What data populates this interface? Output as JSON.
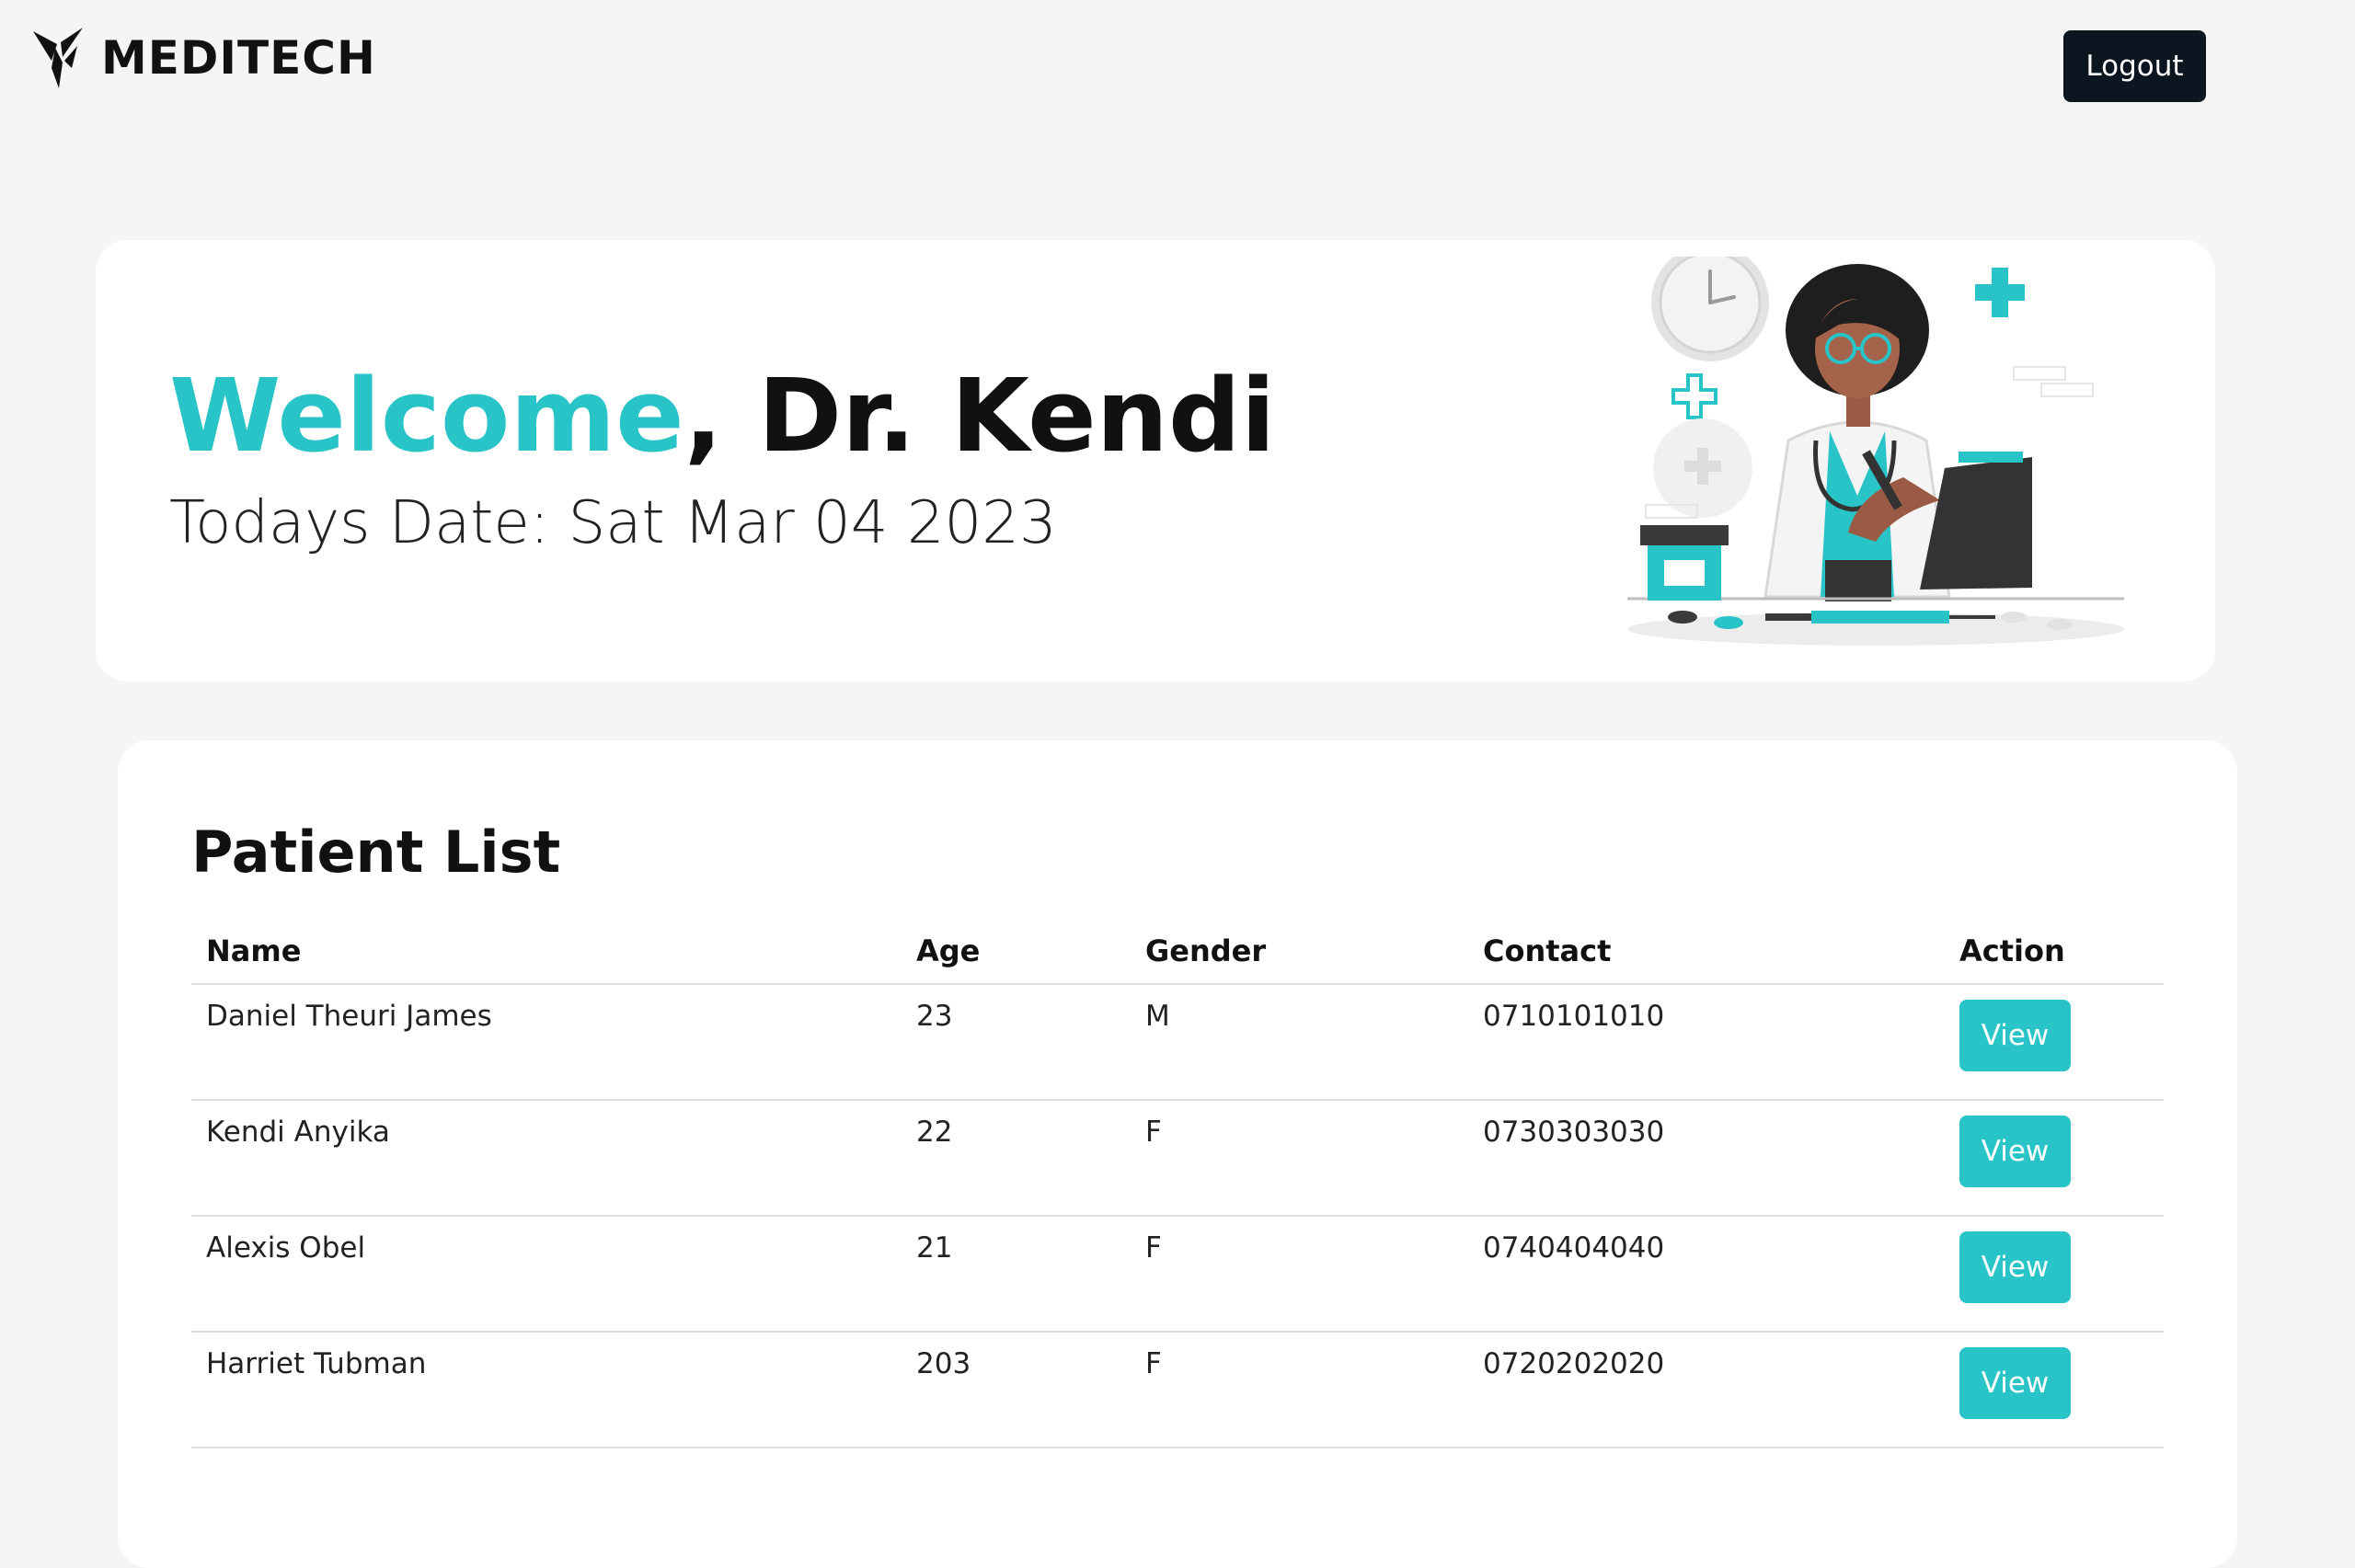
{
  "header": {
    "brand_name": "MEDITECH",
    "logout_label": "Logout"
  },
  "welcome": {
    "greeting_word": "Welcome",
    "greeting_rest": ", Dr. Kendi",
    "date_text": "Todays Date: Sat Mar 04 2023"
  },
  "patients": {
    "title": "Patient List",
    "columns": [
      "Name",
      "Age",
      "Gender",
      "Contact",
      "Action"
    ],
    "rows": [
      {
        "name": "Daniel Theuri James",
        "age": "23",
        "gender": "M",
        "contact": "0710101010",
        "action": "View"
      },
      {
        "name": "Kendi Anyika",
        "age": "22",
        "gender": "F",
        "contact": "0730303030",
        "action": "View"
      },
      {
        "name": "Alexis Obel",
        "age": "21",
        "gender": "F",
        "contact": "0740404040",
        "action": "View"
      },
      {
        "name": "Harriet Tubman",
        "age": "203",
        "gender": "F",
        "contact": "0720202020",
        "action": "View"
      }
    ]
  },
  "colors": {
    "accent": "#29c4c8",
    "dark_button": "#0b1620",
    "background": "#f5f5f5",
    "card": "#ffffff"
  },
  "icons": {
    "brand_logo": "meditech-logo-icon",
    "illustration": "doctor-illustration"
  }
}
